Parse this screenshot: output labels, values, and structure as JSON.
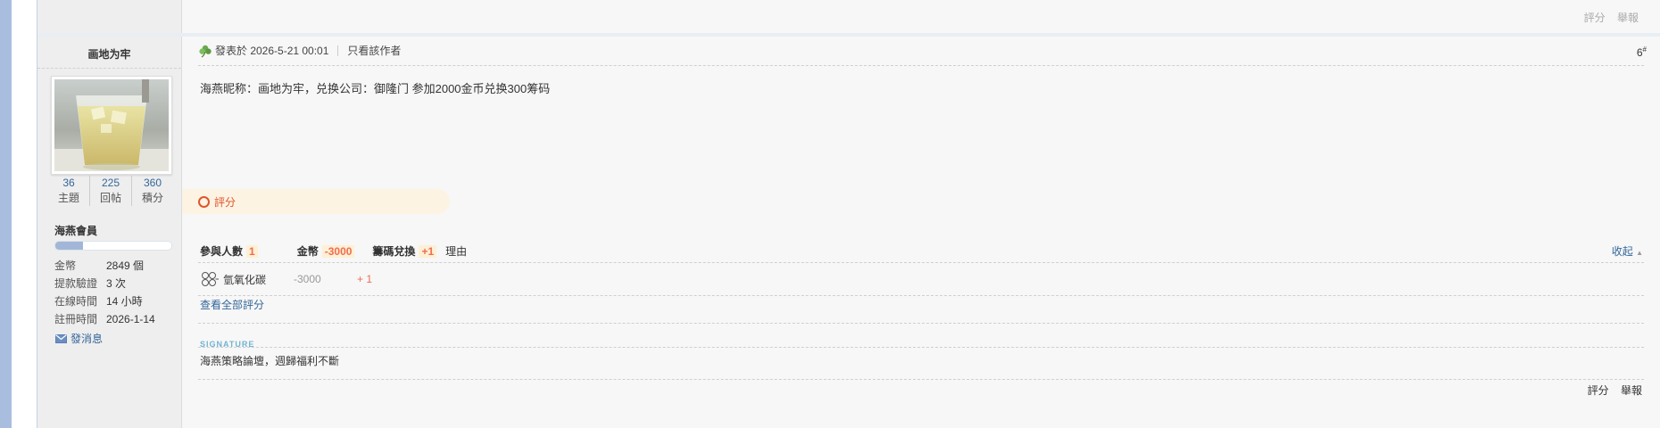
{
  "prev_post": {
    "rate_label": "評分",
    "report_label": "舉報"
  },
  "author": {
    "name": "画地为牢",
    "stats": [
      {
        "num": "36",
        "label": "主題"
      },
      {
        "num": "225",
        "label": "回帖"
      },
      {
        "num": "360",
        "label": "積分"
      }
    ],
    "group": "海燕會員",
    "level_progress": 0.24,
    "info": [
      {
        "key": "金幣",
        "value": "2849 個"
      },
      {
        "key": "提款驗證",
        "value": "3 次"
      },
      {
        "key": "在線時間",
        "value": "14 小時"
      },
      {
        "key": "註冊時間",
        "value": "2026-1-14"
      }
    ],
    "message_label": "發消息"
  },
  "post": {
    "posted_at": "發表於 2026-5-21 00:01",
    "only_author": "只看該作者",
    "floor": "6",
    "floor_sup": "#",
    "content": "海燕昵称：画地为牢，兑换公司：御隆门  参加2000金币兑换300筹码"
  },
  "rating": {
    "tab_label": "評分",
    "head_participants": "參與人數",
    "head_participants_count": "1",
    "head_gold": "金幣",
    "head_gold_total": "-3000",
    "head_chips": "籌碼兌換",
    "head_chips_total": "+1",
    "head_reason": "理由",
    "collapse_label": "收起",
    "rows": [
      {
        "user": "氫氧化碳",
        "gold": "-3000",
        "chips": "+ 1"
      }
    ],
    "view_all": "查看全部評分"
  },
  "signature": {
    "title": "SIGNATURE",
    "text": "海燕策略論壇，週歸福利不斷"
  },
  "actions": {
    "rate_label": "評分",
    "report_label": "舉報"
  },
  "colors": {
    "link": "#336699",
    "accent": "#e0542e",
    "sidebar_bg": "#eeeeee",
    "left_bar": "#a9bedf"
  }
}
